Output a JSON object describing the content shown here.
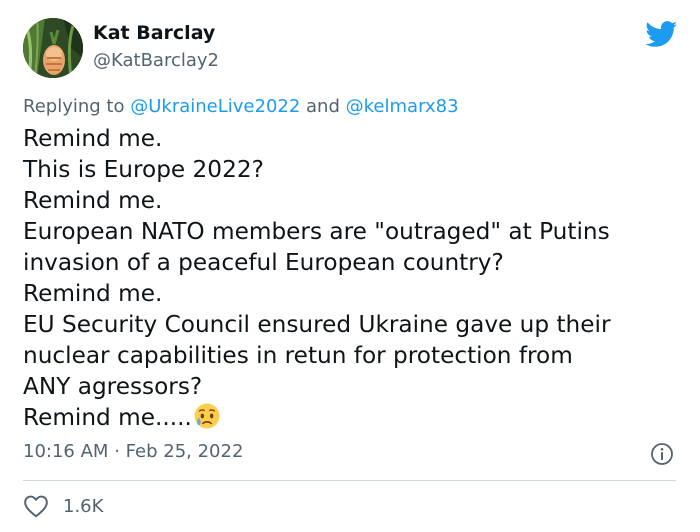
{
  "author": {
    "name": "Kat Barclay",
    "handle": "@KatBarclay2"
  },
  "reply": {
    "prefix": "Replying to",
    "mention_1": "@UkraineLive2022",
    "conjunction": "and",
    "mention_2": "@kelmarx83"
  },
  "tweet_lines": [
    "Remind me.",
    "This is Europe 2022?",
    "Remind me.",
    "European NATO members are \"outraged\" at Putins",
    "invasion of a peaceful European country?",
    "Remind me.",
    "EU Security Council ensured Ukraine gave up their",
    "nuclear capabilities in retun for protection from",
    "ANY agressors?",
    "Remind me....."
  ],
  "emoji": "sad-but-relieved-face-icon",
  "timestamp": {
    "time": "10:16 AM",
    "separator": "·",
    "date": "Feb 25, 2022"
  },
  "likes": {
    "count": "1.6K",
    "icon": "heart-icon"
  },
  "colors": {
    "twitter_blue": "#1d9bf0",
    "text_primary": "#0f1419",
    "text_secondary": "#536471",
    "divider": "#cfd9de"
  },
  "icons": {
    "logo": "twitter-bird-icon",
    "info": "info-icon"
  }
}
